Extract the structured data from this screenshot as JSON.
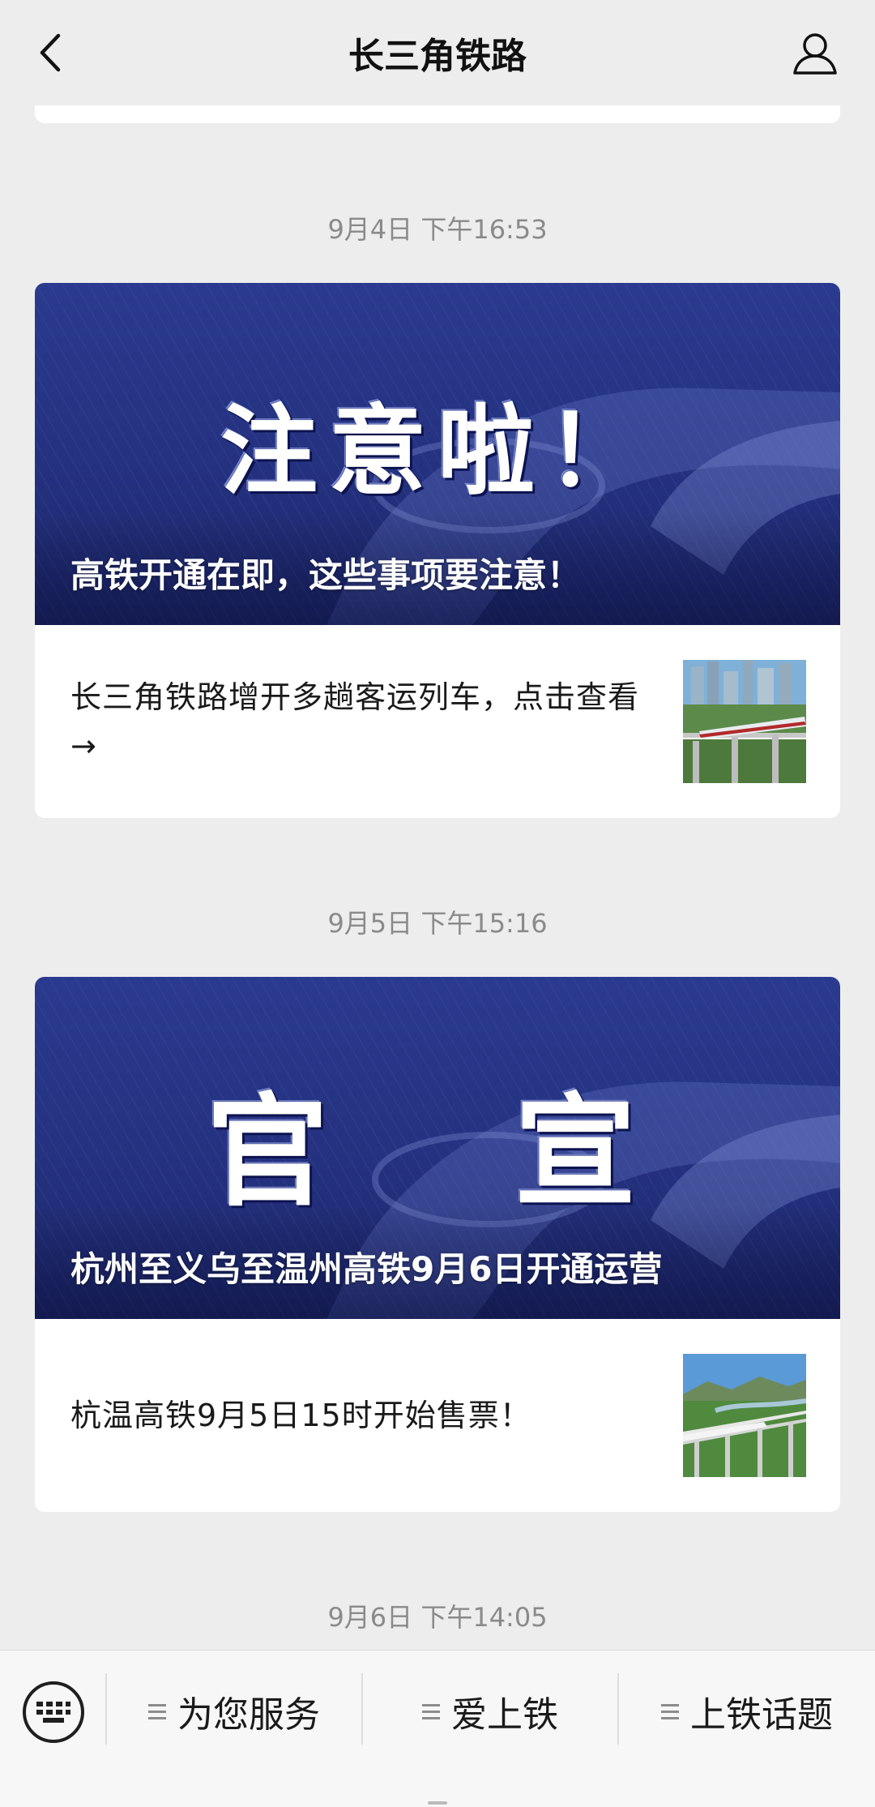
{
  "header": {
    "title": "长三角铁路",
    "back_icon": "chevron-left-icon",
    "profile_icon": "user-icon"
  },
  "messages": [
    {
      "timestamp": "9月4日 下午16:53",
      "cover_big_text": "注意啦！",
      "cover_caption": "高铁开通在即，这些事项要注意！",
      "sub_text": "长三角铁路增开多趟客运列车，点击查看→"
    },
    {
      "timestamp": "9月5日 下午15:16",
      "cover_big_text": "官　宣",
      "cover_caption": "杭州至义乌至温州高铁9月6日开通运营",
      "sub_text": "杭温高铁9月5日15时开始售票！"
    },
    {
      "timestamp": "9月6日 下午14:05"
    }
  ],
  "bottom_menu": {
    "keyboard_icon": "keyboard-icon",
    "items": [
      {
        "label": "为您服务"
      },
      {
        "label": "爱上铁"
      },
      {
        "label": "上铁话题"
      }
    ]
  },
  "colors": {
    "background": "#ededed",
    "cover_blue": "#24317f",
    "timestamp": "#8a8a8a"
  }
}
